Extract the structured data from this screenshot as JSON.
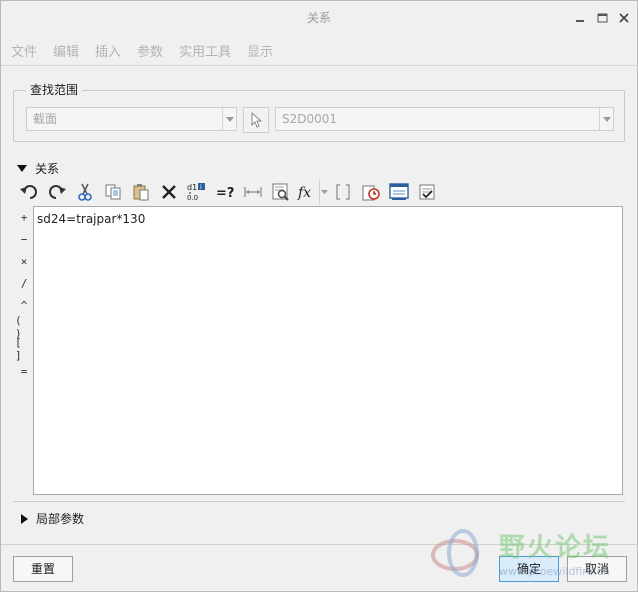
{
  "window": {
    "title": "关系"
  },
  "menu": [
    "文件",
    "编辑",
    "插入",
    "参数",
    "实用工具",
    "显示"
  ],
  "lookin": {
    "label": "查找范围",
    "type_value": "截面",
    "item_value": "S2D0001"
  },
  "relations": {
    "label": "关系",
    "text": "sd24=trajpar*130",
    "operators": [
      "+",
      "−",
      "×",
      "/",
      "^",
      "( )",
      "[ ]",
      "="
    ]
  },
  "toolbar": {
    "icons": [
      "undo-icon",
      "redo-icon",
      "cut-icon",
      "copy-icon",
      "paste-icon",
      "delete-icon",
      "decimal-icon",
      "evaluate-icon",
      "dimension-icon",
      "info-icon",
      "function-icon",
      "bracket-icon",
      "unit-icon",
      "sort-icon",
      "verify-icon"
    ],
    "fx_label": "fx",
    "eq_label": "=?"
  },
  "local_params": {
    "label": "局部参数"
  },
  "buttons": {
    "reset": "重置",
    "ok": "确定",
    "cancel": "取消"
  },
  "watermark": {
    "text": "野火论坛",
    "url": "www.proewildfire.cn"
  },
  "colors": {
    "accent": "#4c9ad6",
    "disabled_text": "#a8a8a8"
  }
}
